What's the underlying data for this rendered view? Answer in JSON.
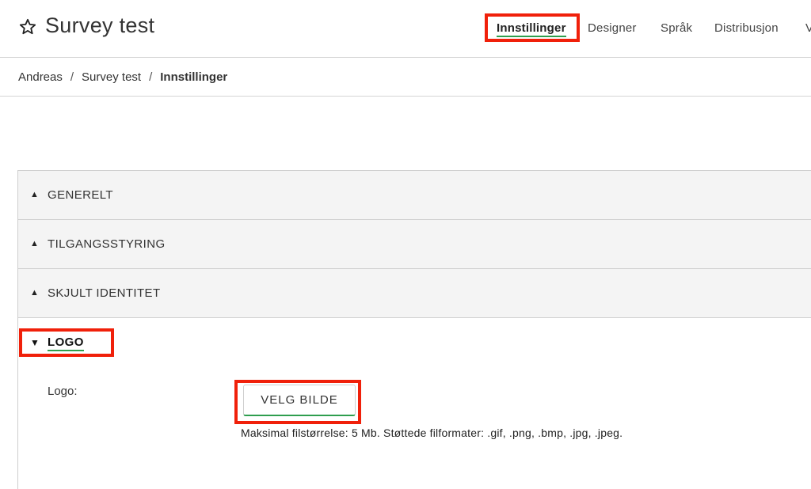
{
  "header": {
    "title": "Survey test",
    "nav": [
      {
        "label": "Innstillinger",
        "active": true
      },
      {
        "label": "Designer"
      },
      {
        "label": "Språk"
      },
      {
        "label": "Distribusjon"
      },
      {
        "label": "V"
      }
    ]
  },
  "breadcrumb": [
    "Andreas",
    "Survey test",
    "Innstillinger"
  ],
  "accordion": {
    "sections": [
      {
        "label": "GENERELT",
        "arrow": "▲"
      },
      {
        "label": "TILGANGSSTYRING",
        "arrow": "▲"
      },
      {
        "label": "SKJULT IDENTITET",
        "arrow": "▲"
      }
    ],
    "logo": {
      "label": "LOGO",
      "arrow": "▼",
      "field_label": "Logo:",
      "button_label": "VELG BILDE",
      "help_text": "Maksimal filstørrelse: 5 Mb. Støttede filformater: .gif, .png, .bmp, .jpg, .jpeg."
    }
  },
  "colors": {
    "accent_green": "#2e9e4e",
    "highlight_red": "#f0200a",
    "section_bg": "#f4f4f4"
  }
}
